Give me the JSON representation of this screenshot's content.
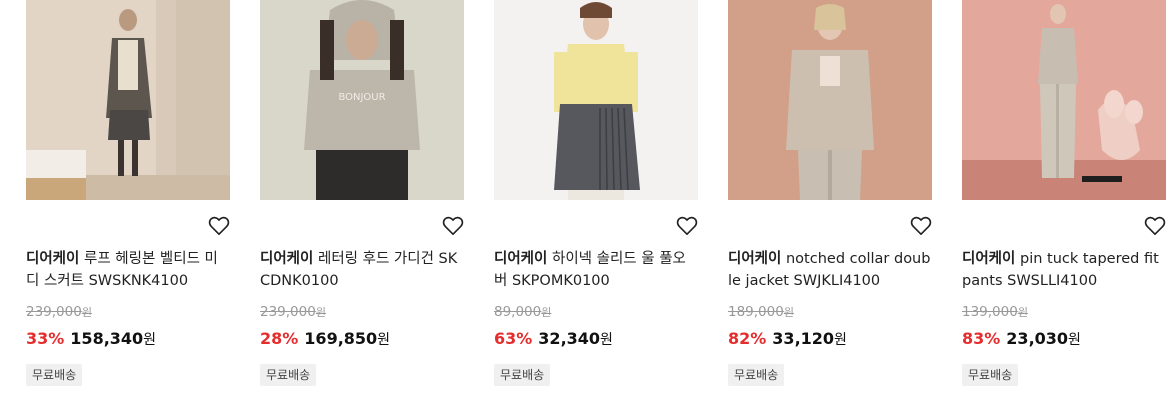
{
  "products": [
    {
      "brand": "디어케이",
      "name": "루프 헤링본 벨티드 미디 스커트 SWSKNK4100",
      "original_price": "239,000",
      "discount": "33%",
      "price": "158,340",
      "currency": "원",
      "badge": "무료배송",
      "wishlist_icon": "heart-outline-icon"
    },
    {
      "brand": "디어케이",
      "name": "레터링 후드 가디건 SKCDNK0100",
      "original_price": "239,000",
      "discount": "28%",
      "price": "169,850",
      "currency": "원",
      "badge": "무료배송",
      "wishlist_icon": "heart-outline-icon"
    },
    {
      "brand": "디어케이",
      "name": "하이넥 솔리드 울 풀오버 SKPOMK0100",
      "original_price": "89,000",
      "discount": "63%",
      "price": "32,340",
      "currency": "원",
      "badge": "무료배송",
      "wishlist_icon": "heart-outline-icon"
    },
    {
      "brand": "디어케이",
      "name": "notched collar double jacket SWJKLI4100",
      "original_price": "189,000",
      "discount": "82%",
      "price": "33,120",
      "currency": "원",
      "badge": "무료배송",
      "wishlist_icon": "heart-outline-icon"
    },
    {
      "brand": "디어케이",
      "name": "pin tuck tapered fit pants SWSLLI4100",
      "original_price": "139,000",
      "discount": "83%",
      "price": "23,030",
      "currency": "원",
      "badge": "무료배송",
      "wishlist_icon": "heart-outline-icon"
    }
  ],
  "colors": {
    "discount": "#e52d2d",
    "original_price": "#999999",
    "badge_bg": "#f0f0f0"
  }
}
